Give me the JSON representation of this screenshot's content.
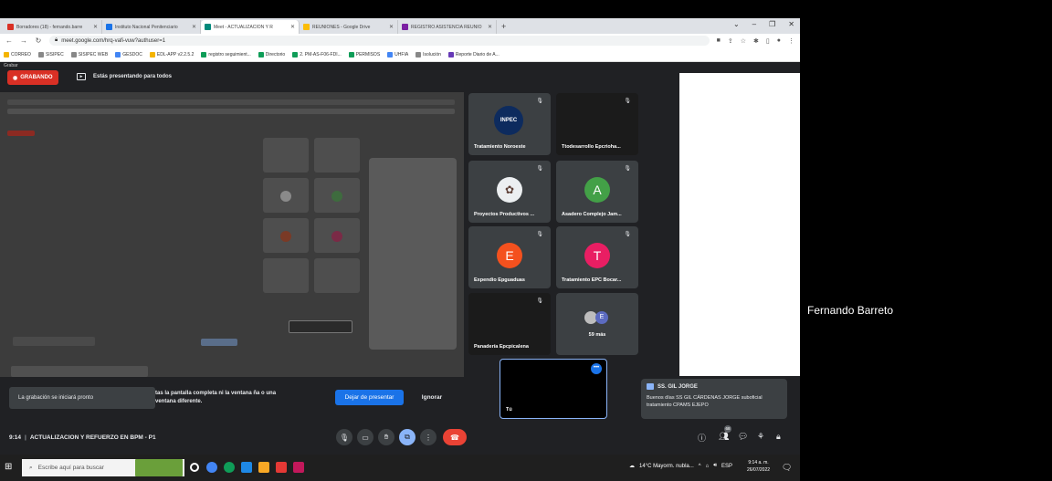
{
  "browser": {
    "tabs": [
      {
        "title": "Borradores (18) - fernando.barre",
        "color": "#d93025"
      },
      {
        "title": "Instituto Nacional Penitenciario",
        "color": "#1a73e8"
      },
      {
        "title": "Meet - ACTUALIZACION Y R",
        "color": "#00897b"
      },
      {
        "title": "REUNIONES - Google Drive",
        "color": "#fbbc04"
      },
      {
        "title": "REGISTRO ASISTENCIA REUNIO",
        "color": "#7b1fa2"
      }
    ],
    "new_tab": "+",
    "url": "meet.google.com/hrq-vafi-vuw?authuser=1",
    "bookmarks": [
      "CORREO",
      "SISIPEC",
      "SISIPEC WEB",
      "GESDOC",
      "EDL-APP v2.2.5.2",
      "registro seguimient...",
      "Directorio",
      "2. PM-AS-F06-FDI...",
      "PERMISOS",
      "UHFIA",
      "Isolución",
      "Reporte Diario de A..."
    ]
  },
  "meet": {
    "top_label": "Grabar",
    "recording_label": "GRABANDO",
    "presenting_label": "Estás presentando para todos",
    "participants": [
      {
        "name": "Tratamiento Noroeste",
        "avatar": "",
        "avatar_color": ""
      },
      {
        "name": "Ttodesarrollo Epcrioha...",
        "avatar": "",
        "avatar_color": ""
      },
      {
        "name": "Proyectos Productivos ...",
        "avatar": "",
        "avatar_color": ""
      },
      {
        "name": "Asadero Complejo Jam...",
        "avatar": "A",
        "avatar_color": "#43a047"
      },
      {
        "name": "Expendio Epguaduas",
        "avatar": "E",
        "avatar_color": "#f4511e"
      },
      {
        "name": "Tratamiento EPC Bocar...",
        "avatar": "T",
        "avatar_color": "#e91e63"
      },
      {
        "name": "Panadería Epcpicalena",
        "avatar": "",
        "avatar_color": ""
      },
      {
        "name": "59 más",
        "avatar": "E",
        "avatar_color": "#5c6bc0"
      }
    ],
    "self_name": "Tú",
    "recording_toast": "La grabación se iniciará pronto",
    "warning_text": "tas la pantalla completa ni la ventana ña o una ventana diferente.",
    "stop_presenting": "Dejar de presentar",
    "ignore": "Ignorar",
    "chat": {
      "author": "SS. GIL JORGE",
      "message": "Buenos días SS GIL CÁRDENAS JORGE suboficial tratamiento CPAMS EJEPO"
    },
    "meeting_time": "9:14",
    "meeting_title": "ACTUALIZACION Y REFUERZO EN BPM - P1",
    "people_count": "68"
  },
  "right_panel": {
    "participant_name": "Fernando Barreto"
  },
  "taskbar": {
    "search_placeholder": "Escribe aquí para buscar",
    "weather": "14°C Mayorm. nubla...",
    "language": "ESP",
    "time": "9:14 a. m.",
    "date": "26/07/2022"
  }
}
